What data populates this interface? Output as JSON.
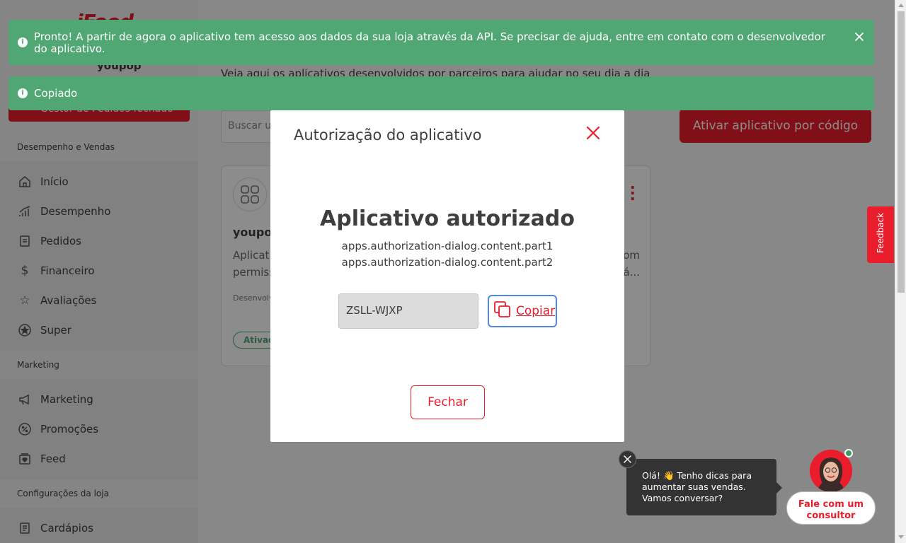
{
  "sidebar": {
    "brand": "iFood",
    "store_name": "youpop",
    "store_status": "Gestor de Pedidos fechado",
    "sections": {
      "performance": "Desempenho e Vendas",
      "marketing": "Marketing",
      "settings": "Configurações da loja"
    },
    "items": [
      {
        "label": "Início",
        "icon": "home-icon"
      },
      {
        "label": "Desempenho",
        "icon": "chart-icon"
      },
      {
        "label": "Pedidos",
        "icon": "orders-icon"
      },
      {
        "label": "Financeiro",
        "icon": "dollar-icon"
      },
      {
        "label": "Avaliações",
        "icon": "star-icon"
      },
      {
        "label": "Super",
        "icon": "super-star-icon"
      },
      {
        "label": "Marketing",
        "icon": "megaphone-icon"
      },
      {
        "label": "Promoções",
        "icon": "percent-icon"
      },
      {
        "label": "Feed",
        "icon": "feed-icon"
      },
      {
        "label": "Cardápios",
        "icon": "menu-book-icon"
      }
    ]
  },
  "main": {
    "subtitle": "Veja aqui os aplicativos desenvolvidos por parceiros para ajudar no seu dia a dia",
    "search_placeholder": "Buscar u",
    "activate_button": "Ativar aplicativo por código",
    "card": {
      "name": "youpo",
      "description_line1": "Aplicati",
      "description_line1_end": "om",
      "description_line2": "permiss",
      "description_line2_end": "á...",
      "developer": "Desenvolv",
      "badge": "Ativad"
    }
  },
  "toasts": [
    {
      "text": "Pronto! A partir de agora o aplicativo tem acesso aos dados da sua loja através da API. Se precisar de ajuda, entre em contato com o desenvolvedor do aplicativo."
    },
    {
      "text": "Copiado"
    }
  ],
  "modal": {
    "title": "Autorização do aplicativo",
    "heading": "Aplicativo autorizado",
    "line1": "apps.authorization-dialog.content.part1",
    "line2": "apps.authorization-dialog.content.part2",
    "code": "ZSLL-WJXP",
    "copy_label": "Copiar",
    "close_label": "Fechar"
  },
  "feedback": {
    "label": "Feedback"
  },
  "chat": {
    "line1": "Olá! 👋 Tenho dicas para",
    "line2": "aumentar suas vendas.",
    "line3": "Vamos conversar?",
    "button_line1": "Fale com um",
    "button_line2": "consultor"
  },
  "colors": {
    "brand_red": "#ea1d2c",
    "success_green": "#50a773",
    "focus_blue": "#4f86e8"
  }
}
